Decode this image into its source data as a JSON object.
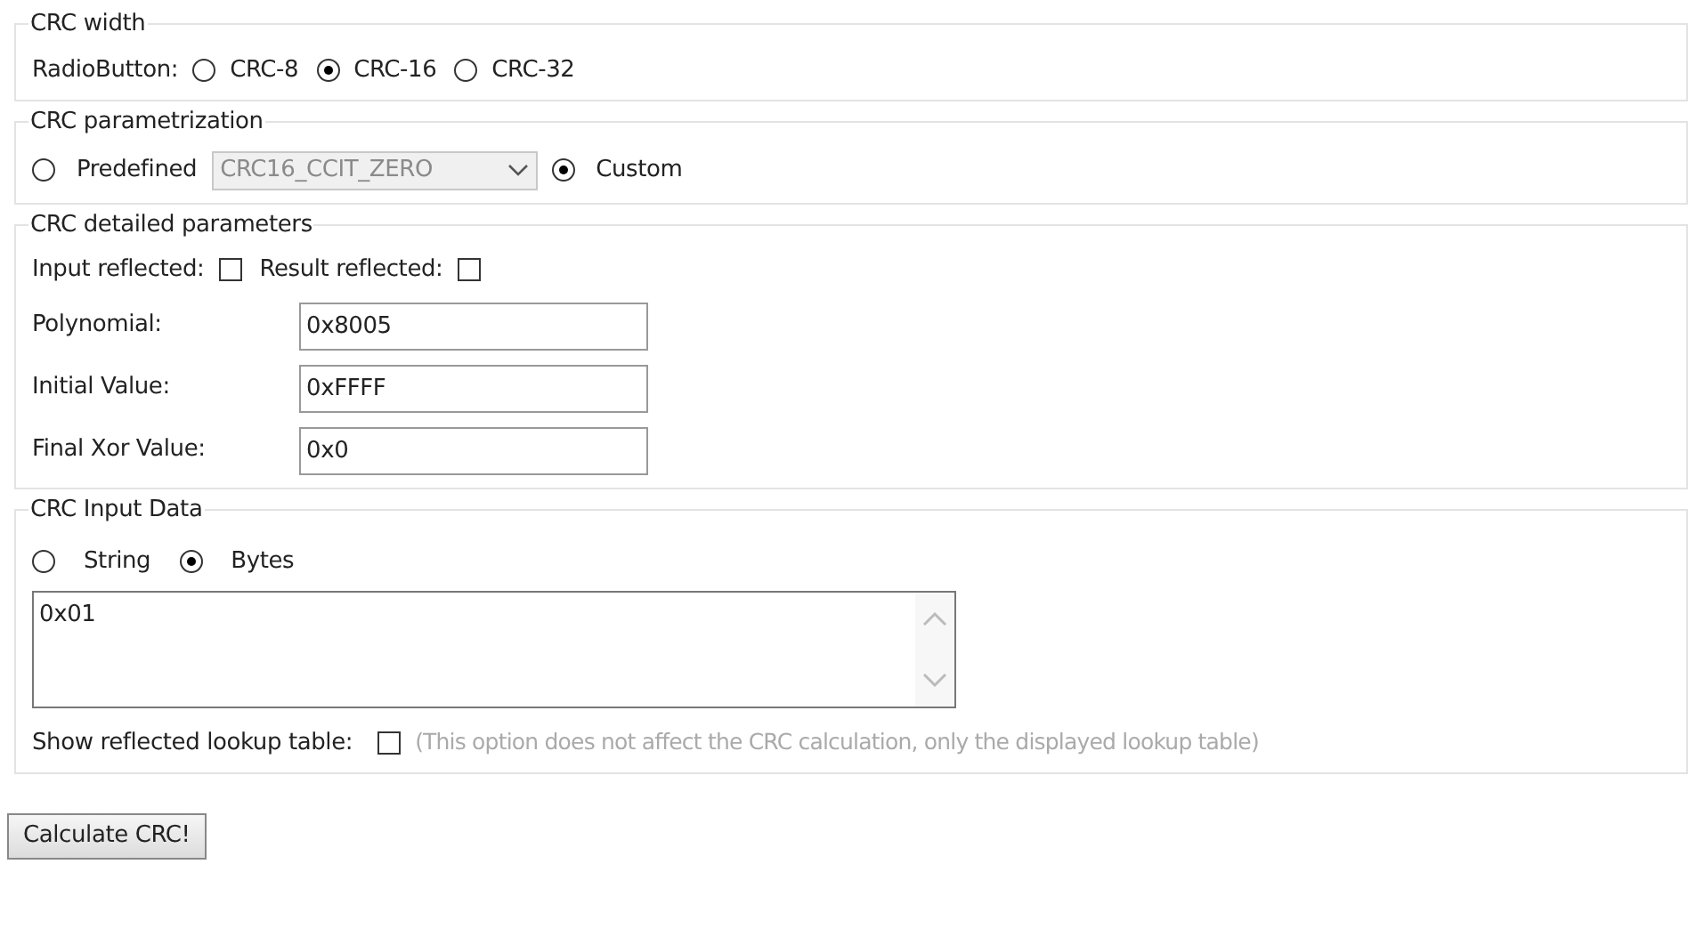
{
  "crc_width": {
    "legend": "CRC width",
    "label": "RadioButton:",
    "options": [
      {
        "label": "CRC-8",
        "selected": false
      },
      {
        "label": "CRC-16",
        "selected": true
      },
      {
        "label": "CRC-32",
        "selected": false
      }
    ]
  },
  "parametrization": {
    "legend": "CRC parametrization",
    "predefined": {
      "label": "Predefined",
      "selected": false
    },
    "preset_select": {
      "value": "CRC16_CCIT_ZERO",
      "disabled": true
    },
    "custom": {
      "label": "Custom",
      "selected": true
    }
  },
  "detailed": {
    "legend": "CRC detailed parameters",
    "input_reflected": {
      "label": "Input reflected:",
      "checked": false
    },
    "result_reflected": {
      "label": "Result reflected:",
      "checked": false
    },
    "fields": [
      {
        "label": "Polynomial:",
        "value": "0x8005"
      },
      {
        "label": "Initial Value:",
        "value": "0xFFFF"
      },
      {
        "label": "Final Xor Value:",
        "value": "0x0"
      }
    ]
  },
  "input_data": {
    "legend": "CRC Input Data",
    "options": [
      {
        "label": "String",
        "selected": false
      },
      {
        "label": "Bytes",
        "selected": true
      }
    ],
    "value": "0x01",
    "reflected_table": {
      "label": "Show reflected lookup table:",
      "checked": false,
      "note": "(This option does not affect the CRC calculation, only the displayed lookup table)"
    }
  },
  "button": "Calculate CRC!"
}
